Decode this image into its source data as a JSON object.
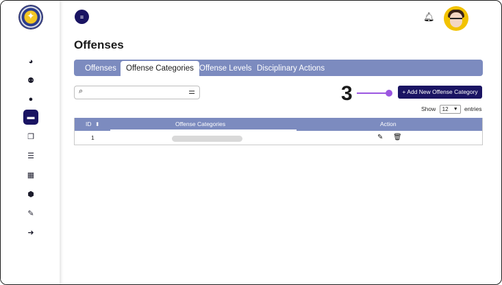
{
  "header": {
    "menu_icon": "menu-icon",
    "bell_icon": "bell-icon"
  },
  "sidebar": {
    "icons": [
      "dashboard-icon",
      "users-group-icon",
      "user-icon",
      "folder-icon",
      "documents-icon",
      "list-icon",
      "calendar-icon",
      "box-icon",
      "report-icon",
      "logout-icon"
    ],
    "active_index": 3
  },
  "page": {
    "title": "Offenses"
  },
  "tabs": [
    {
      "label": "Offenses"
    },
    {
      "label": "Offense Categories"
    },
    {
      "label": "Offense Levels"
    },
    {
      "label": "Disciplinary Actions"
    }
  ],
  "active_tab": 1,
  "search": {
    "placeholder": "",
    "value": ""
  },
  "annotation": {
    "step": "3"
  },
  "add_button": {
    "label": "+  Add New Offense Category"
  },
  "pagination": {
    "show_label": "Show",
    "entries_value": "12",
    "entries_label": "entries"
  },
  "table": {
    "headers": {
      "id": "ID",
      "category": "Offense Categories",
      "action": "Action"
    },
    "rows": [
      {
        "id": "1"
      }
    ]
  },
  "colors": {
    "primary": "#1a1463",
    "tabbar": "#7c8bbf",
    "annotation": "#9b56e0"
  }
}
